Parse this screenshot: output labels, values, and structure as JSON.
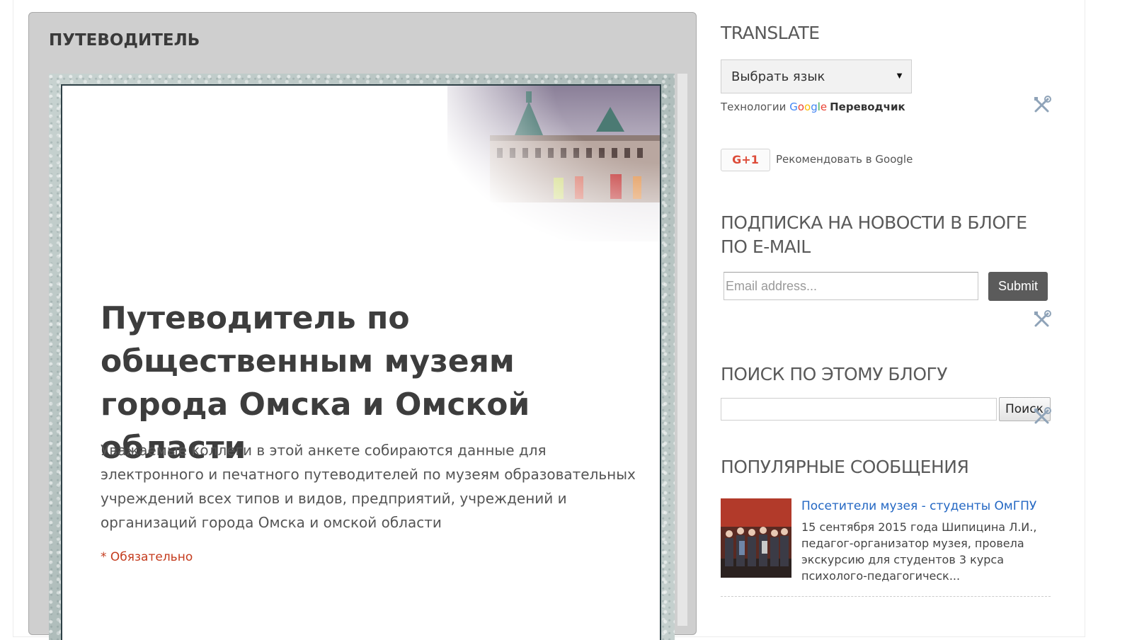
{
  "gadget": {
    "title": "ПУТЕВОДИТЕЛЬ",
    "form": {
      "title": "Путеводитель по общественным музеям города Омска и Омской области",
      "description": "Уважаемые коллеги в этой анкете собираются данные для электронного и печатного путеводителей по музеям образовательных учреждений всех типов и видов, предприятий, учреждений и организаций города Омска и омской области",
      "required_note": "* Обязательно"
    }
  },
  "sidebar": {
    "translate": {
      "title": "TRANSLATE",
      "select_value": "Выбрать язык",
      "powered_prefix": "Технологии",
      "google_letters": [
        "G",
        "o",
        "o",
        "g",
        "l",
        "e"
      ],
      "powered_suffix": "Переводчик"
    },
    "gplus": {
      "button": "G+1",
      "label": "Рекомендовать в Google"
    },
    "subscribe": {
      "title": "ПОДПИСКА НА НОВОСТИ В БЛОГЕ ПО E-MAIL",
      "placeholder": "Email address...",
      "submit": "Submit"
    },
    "search": {
      "title": "ПОИСК ПО ЭТОМУ БЛОГУ",
      "button": "Поиск"
    },
    "popular": {
      "title": "ПОПУЛЯРНЫЕ СООБЩЕНИЯ",
      "posts": [
        {
          "title": "Посетители музея - студенты ОмГПУ",
          "snippet": "15 сентября 2015 года Шипицина Л.И., педагог-организатор музея, провела экскурсию для студентов 3 курса психолого-педагогическ..."
        }
      ]
    }
  },
  "colors": {
    "gadget_bg": "#cfcfcf",
    "link": "#2367c3",
    "required": "#c43b1d",
    "submit_bg": "#5b5b5b",
    "gplus_red": "#dd4b39"
  },
  "icons": [
    "wrench-screwdriver-icon",
    "dropdown-caret-icon",
    "gplus-icon"
  ]
}
